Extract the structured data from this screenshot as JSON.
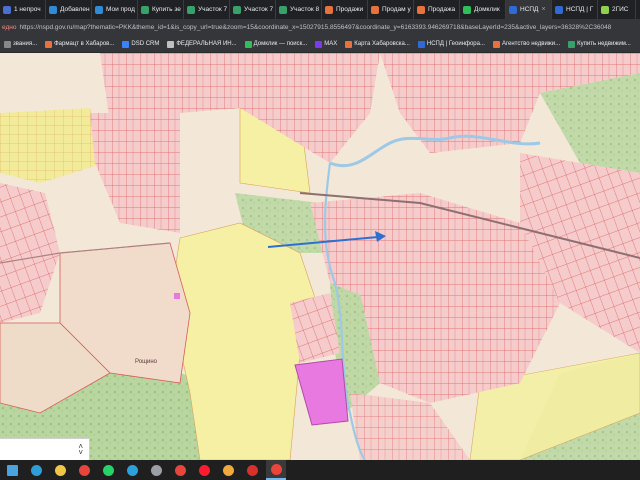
{
  "browser": {
    "tabs": [
      {
        "label": "1 непроч",
        "icon": "mail-icon",
        "color": "#4a6fd1"
      },
      {
        "label": "Добавлен",
        "icon": "site-icon",
        "color": "#2f8bd5"
      },
      {
        "label": "Мои прод",
        "icon": "site-icon",
        "color": "#2f8bd5"
      },
      {
        "label": "Купить зе",
        "icon": "site-icon",
        "color": "#38a169"
      },
      {
        "label": "Участок 7",
        "icon": "site-icon",
        "color": "#38a169"
      },
      {
        "label": "Участок 7",
        "icon": "site-icon",
        "color": "#38a169"
      },
      {
        "label": "Участок 8",
        "icon": "site-icon",
        "color": "#38a169"
      },
      {
        "label": "Продажи",
        "icon": "site-icon",
        "color": "#e8713c"
      },
      {
        "label": "Продам у",
        "icon": "site-icon",
        "color": "#e8713c"
      },
      {
        "label": "Продажа",
        "icon": "site-icon",
        "color": "#e8713c"
      },
      {
        "label": "Домклик",
        "icon": "site-icon",
        "color": "#2fbf5a"
      },
      {
        "label": "НСПД",
        "icon": "site-icon",
        "color": "#2f6ad5",
        "active": true
      },
      {
        "label": "НСПД | Г",
        "icon": "site-icon",
        "color": "#2f6ad5"
      },
      {
        "label": "2ГИС",
        "icon": "site-icon",
        "color": "#8fd14f"
      }
    ],
    "address": {
      "warning": "едно",
      "url": "https://nspd.gov.ru/map?thematic=PKK&theme_id=1&is_copy_url=true&zoom=15&coordinate_x=15027915.8556497&coordinate_y=6163393.946269718&baseLayerId=235&active_layers=36328%2C36048"
    },
    "bookmarks": [
      {
        "label": "звания...",
        "color": "#888888"
      },
      {
        "label": "Фармацт в Хабаров...",
        "color": "#e8713c"
      },
      {
        "label": "DSD CRM",
        "color": "#3b82f6"
      },
      {
        "label": "ФЕДЕРАЛЬНАЯ ИН...",
        "color": "#c0c0c0"
      },
      {
        "label": "Домклик — поиск...",
        "color": "#2fbf5a"
      },
      {
        "label": "MAX",
        "color": "#7c3aed"
      },
      {
        "label": "Карта Хабаровска...",
        "color": "#e8713c"
      },
      {
        "label": "НСПД | Геоинфора...",
        "color": "#2f6ad5"
      },
      {
        "label": "Агентство недвижи...",
        "color": "#e8713c"
      },
      {
        "label": "Купить недвижим...",
        "color": "#38a169"
      }
    ]
  },
  "map": {
    "place_label": "Рощино",
    "annotation": "blue-arrow pointing to parcel area",
    "colors": {
      "land": "#f3e7d8",
      "parcel": "#f5cccb",
      "parcel_border": "#d95a5a",
      "zone_yellow": "#f5f0a3",
      "forest": "#b9d6a1",
      "highlight": "#e879e0",
      "arrow": "#2f6fd1",
      "river": "#9dc9e6"
    }
  },
  "scroll_widget": {
    "up": "˄",
    "down": "˅"
  },
  "taskbar": {
    "icons": [
      {
        "name": "windows-start-icon",
        "color": "#4aa3df"
      },
      {
        "name": "edge-icon",
        "color": "#2c9fd9"
      },
      {
        "name": "file-explorer-icon",
        "color": "#f2c744"
      },
      {
        "name": "chrome-icon",
        "color": "#e8453c"
      },
      {
        "name": "whatsapp-icon",
        "color": "#25d366"
      },
      {
        "name": "telegram-icon",
        "color": "#2aa1da"
      },
      {
        "name": "snipping-tool-icon",
        "color": "#9aa0a6"
      },
      {
        "name": "media-player-icon",
        "color": "#e8453c"
      },
      {
        "name": "opera-icon",
        "color": "#ff1b2d"
      },
      {
        "name": "paint-icon",
        "color": "#f2a93b"
      },
      {
        "name": "acrobat-icon",
        "color": "#d9302c"
      },
      {
        "name": "chrome-active-icon",
        "color": "#e8453c"
      }
    ]
  }
}
